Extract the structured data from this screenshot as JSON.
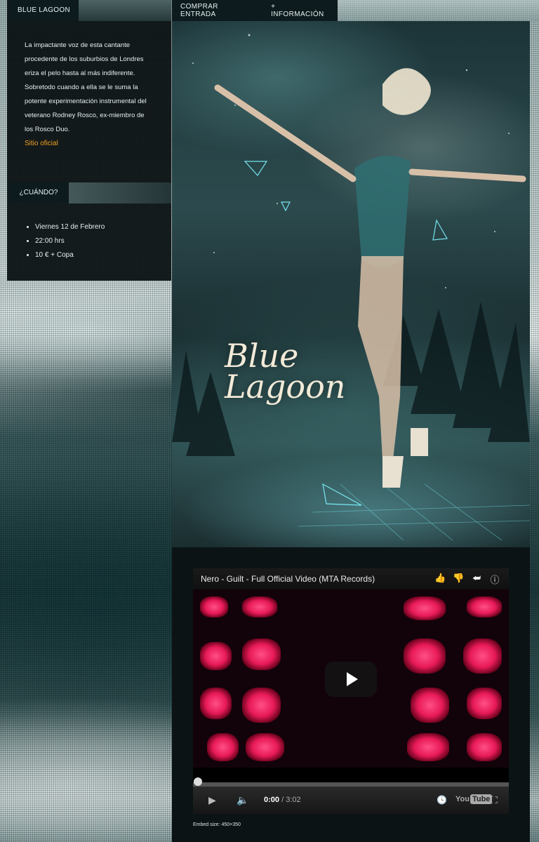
{
  "sidebar": {
    "tab_title": "BLUE LAGOON",
    "description": "La impactante voz de esta cantante procedente de los suburbios de Londres eriza el pelo hasta al más indiferente. Sobretodo cuando a ella se le suma la potente experimentación instrumental del veterano Rodney Rosco, ex-miembro de los Rosco Duo.",
    "official_link": "Sitio oficial",
    "when_label": "¿CUÁNDO?",
    "event_items": [
      "Viernes 12 de Febrero",
      "22:00 hrs",
      "10 € + Copa"
    ]
  },
  "nav": {
    "buy_ticket": "COMPRAR ENTRADA",
    "more_info": "+ INFORMACIÓN"
  },
  "hero": {
    "title_line1": "Blue",
    "title_line2": "Lagoon"
  },
  "video": {
    "title": "Nero - Guilt - Full Official Video (MTA Records)",
    "current_time": "0:00",
    "duration": "/ 3:02",
    "logo_text_you": "You",
    "logo_text_tube": "Tube",
    "progress_fraction": 0,
    "icons": [
      "thumbs-up-icon",
      "thumbs-down-icon",
      "share-icon",
      "info-icon",
      "play-icon",
      "volume-icon",
      "clock-icon",
      "fullscreen-icon"
    ]
  },
  "embed_size": "Embed size: 450×350",
  "colors": {
    "link": "#f0a020",
    "panel": "#0d1b1e"
  }
}
